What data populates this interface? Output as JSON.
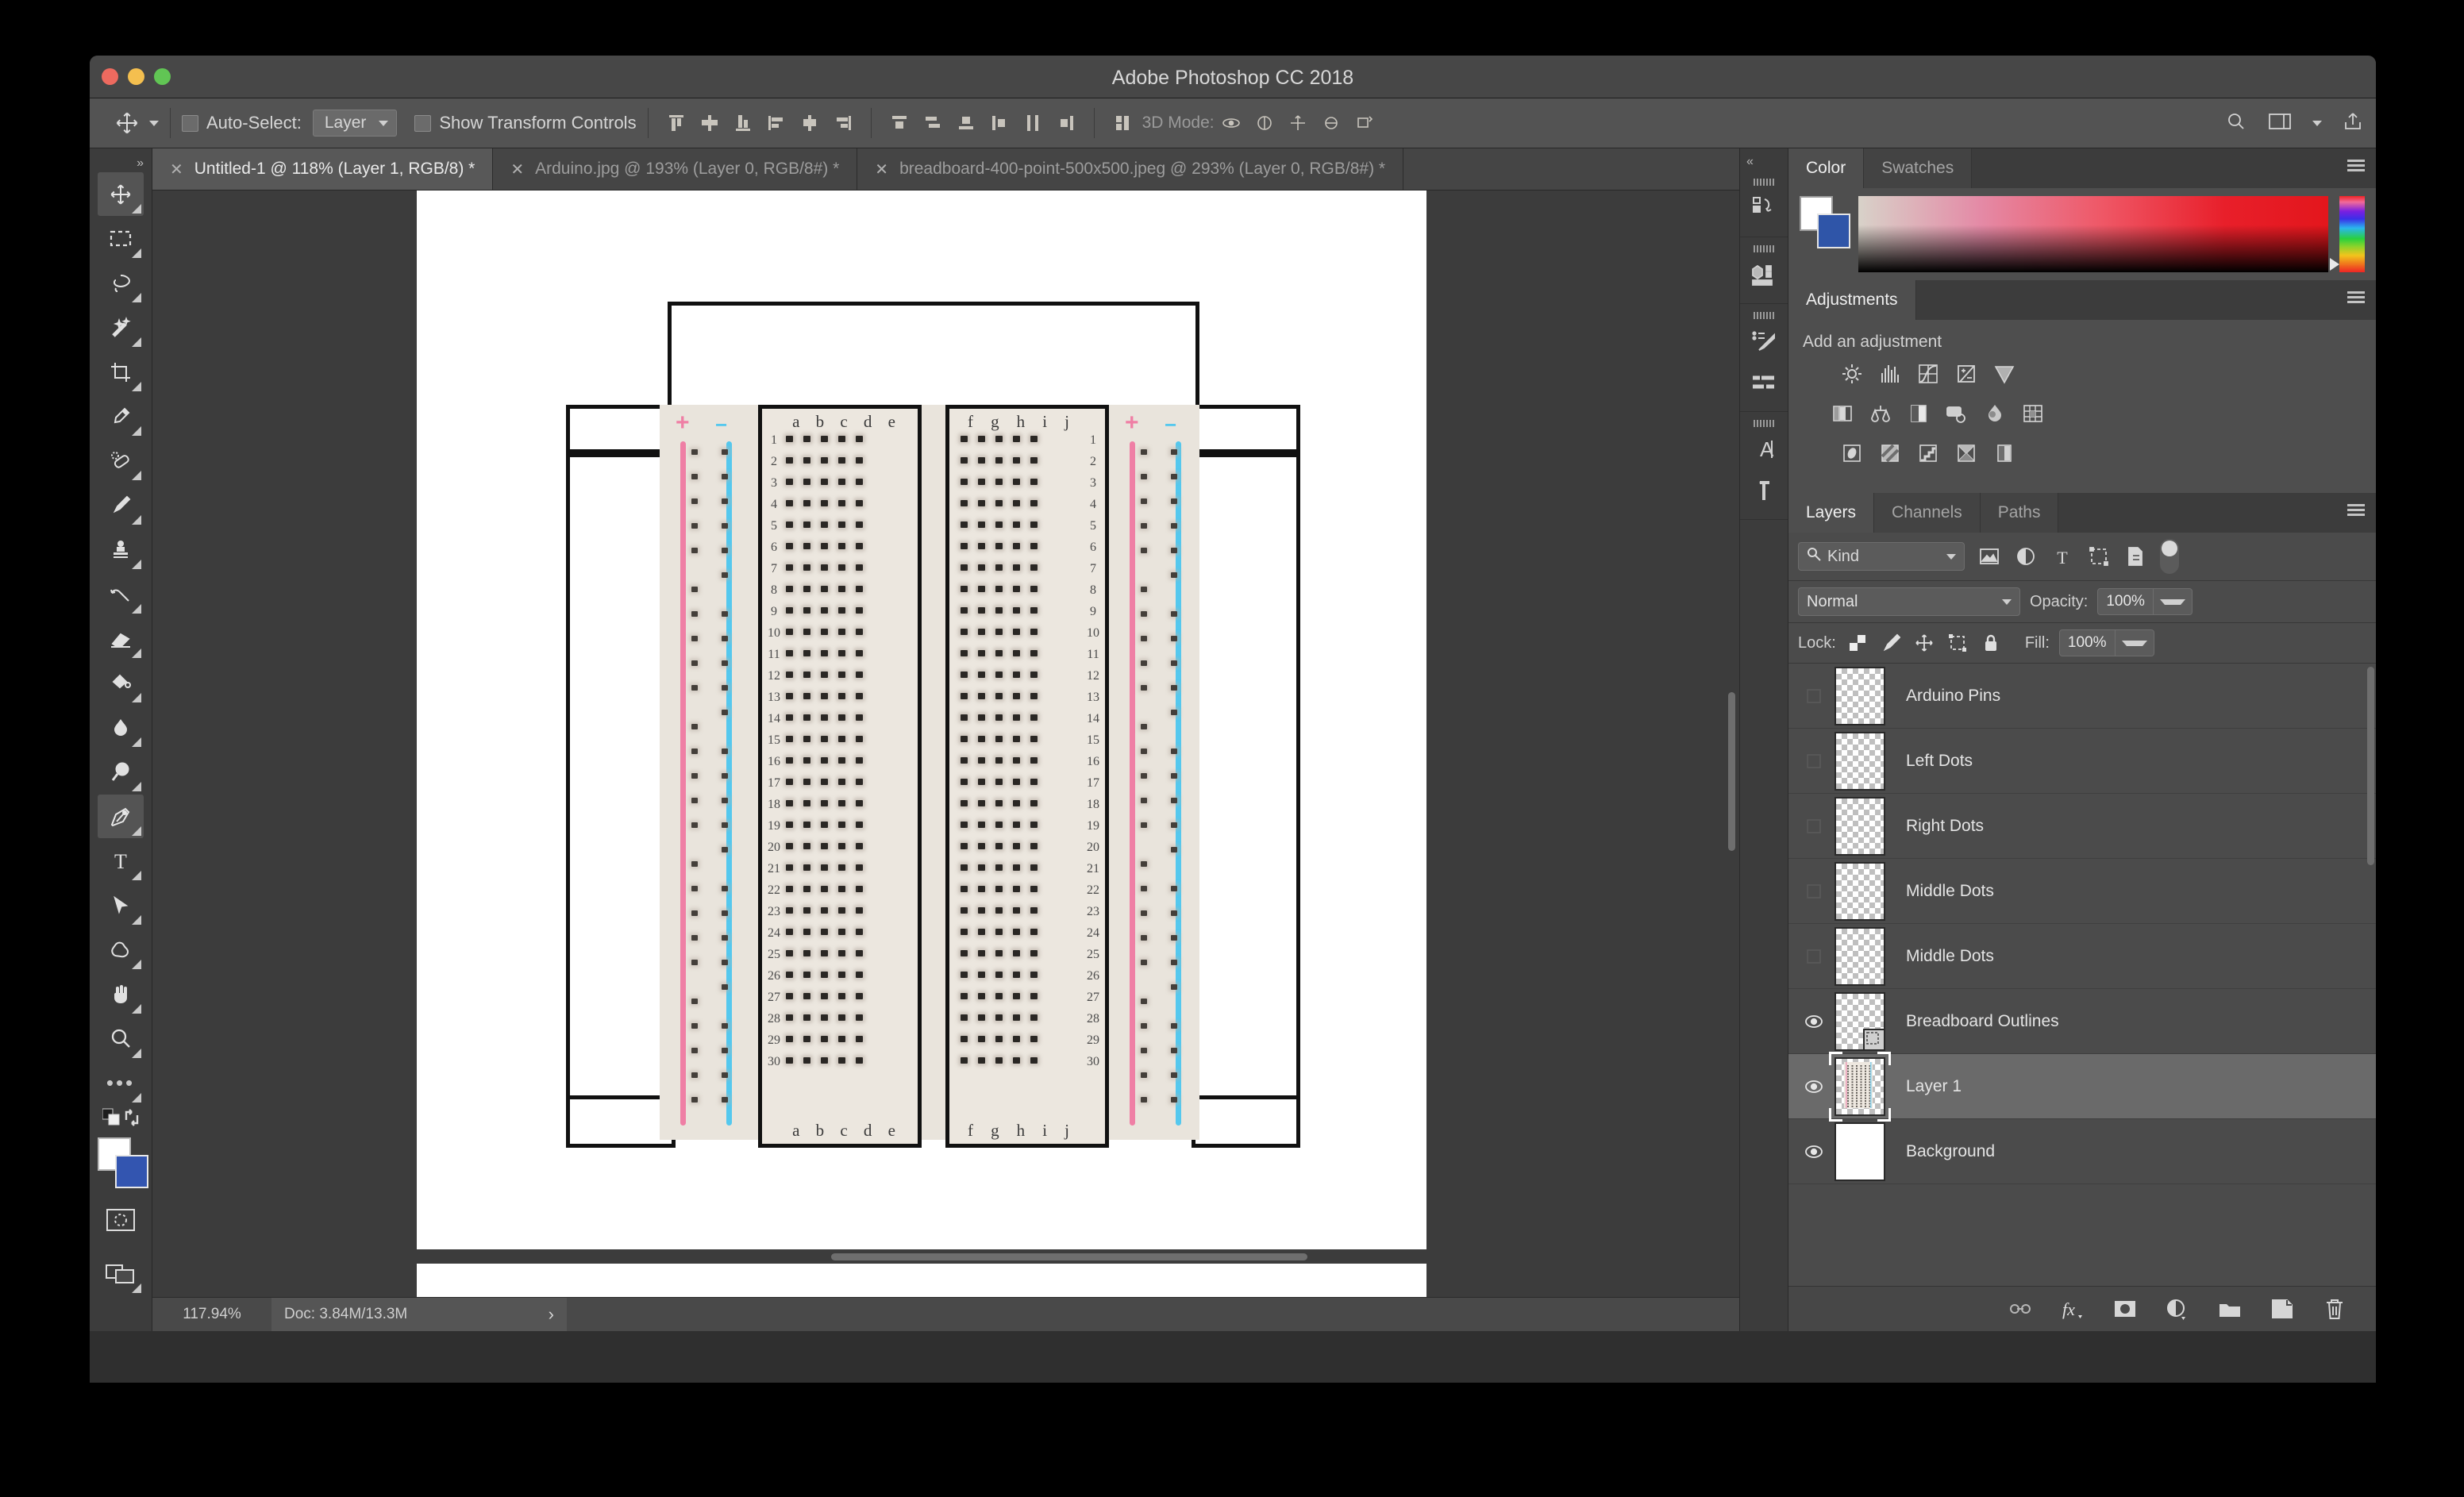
{
  "window": {
    "title": "Adobe Photoshop CC 2018"
  },
  "options_bar": {
    "tool_icon": "move-tool-icon",
    "auto_select_label": "Auto-Select:",
    "auto_select_value": "Layer",
    "show_transform_label": "Show Transform Controls",
    "mode_3d_label": "3D Mode:",
    "align_icons": [
      "align-top-edges",
      "align-vertical-centers",
      "align-bottom-edges",
      "align-left-edges",
      "align-horizontal-centers",
      "align-right-edges"
    ],
    "distribute_icons": [
      "distribute-top-edges",
      "distribute-vertical-centers",
      "distribute-bottom-edges",
      "distribute-left-edges",
      "distribute-horizontal-centers",
      "distribute-right-edges"
    ],
    "extra_icons": [
      "distribute-spacing",
      "3d-orbit",
      "3d-roll",
      "3d-pan",
      "3d-slide",
      "3d-scale"
    ],
    "right_icons": [
      "search-icon",
      "workspace-icon",
      "chevron-down-icon",
      "share-icon"
    ]
  },
  "toolbar": {
    "expand_label": "»",
    "tools": [
      {
        "name": "move-tool",
        "active": true
      },
      {
        "name": "rectangular-marquee-tool",
        "active": false
      },
      {
        "name": "lasso-tool",
        "active": false
      },
      {
        "name": "magic-wand-tool",
        "active": false
      },
      {
        "name": "crop-tool",
        "active": false
      },
      {
        "name": "eyedropper-tool",
        "active": false
      },
      {
        "name": "healing-brush-tool",
        "active": false
      },
      {
        "name": "brush-tool",
        "active": false
      },
      {
        "name": "clone-stamp-tool",
        "active": false
      },
      {
        "name": "history-brush-tool",
        "active": false
      },
      {
        "name": "eraser-tool",
        "active": false
      },
      {
        "name": "gradient-tool",
        "active": false
      },
      {
        "name": "blur-tool",
        "active": false
      },
      {
        "name": "dodge-tool",
        "active": false
      },
      {
        "name": "pen-tool",
        "active": true
      },
      {
        "name": "type-tool",
        "active": false
      },
      {
        "name": "path-selection-tool",
        "active": false
      },
      {
        "name": "custom-shape-tool",
        "active": false
      },
      {
        "name": "hand-tool",
        "active": false
      },
      {
        "name": "zoom-tool",
        "active": false
      },
      {
        "name": "edit-toolbar-tool",
        "active": false
      }
    ],
    "foreground_color": "#ffffff",
    "background_color": "#3355b0"
  },
  "document_tabs": [
    {
      "title": "Untitled-1 @ 118% (Layer 1, RGB/8) *",
      "active": true
    },
    {
      "title": "Arduino.jpg @ 193% (Layer 0, RGB/8#) *",
      "active": false
    },
    {
      "title": "breadboard-400-point-500x500.jpeg @ 293% (Layer 0, RGB/8#) *",
      "active": false
    }
  ],
  "status_bar": {
    "zoom": "117.94%",
    "doc": "Doc: 3.84M/13.3M",
    "arrow": "›"
  },
  "canvas": {
    "breadboard": {
      "left_columns": [
        "a",
        "b",
        "c",
        "d",
        "e"
      ],
      "right_columns": [
        "f",
        "g",
        "h",
        "i",
        "j"
      ],
      "row_numbers": [
        1,
        2,
        3,
        4,
        5,
        6,
        7,
        8,
        9,
        10,
        11,
        12,
        13,
        14,
        15,
        16,
        17,
        18,
        19,
        20,
        21,
        22,
        23,
        24,
        25,
        26,
        27,
        28,
        29,
        30
      ],
      "rail_plus": "+",
      "rail_minus": "−",
      "rail_plus_color": "#ef7fa5",
      "rail_minus_color": "#55c8ee",
      "board_color": "#e9e4dc",
      "outline_color": "#111111"
    }
  },
  "dock": {
    "icons": [
      "history-icon",
      "3d-icon",
      "brush-presets-icon",
      "brush-settings-icon",
      "character-icon",
      "paragraph-icon"
    ]
  },
  "color_panel": {
    "tabs": [
      {
        "label": "Color",
        "active": true
      },
      {
        "label": "Swatches",
        "active": false
      }
    ],
    "menu_icon": "panel-menu-icon",
    "foreground_color": "#ffffff",
    "background_color": "#2f55a8"
  },
  "adjustments_panel": {
    "tab": "Adjustments",
    "menu_icon": "panel-menu-icon",
    "hint": "Add an adjustment",
    "rows": [
      [
        "brightness-contrast-icon",
        "levels-icon",
        "curves-icon",
        "exposure-icon",
        "vibrance-icon"
      ],
      [
        "hue-saturation-icon",
        "color-balance-icon",
        "black-white-icon",
        "photo-filter-icon",
        "channel-mixer-icon",
        "color-lookup-icon"
      ],
      [
        "invert-icon",
        "posterize-icon",
        "threshold-icon",
        "gradient-map-icon",
        "selective-color-icon"
      ]
    ]
  },
  "layers_panel": {
    "tabs": [
      {
        "label": "Layers",
        "active": true
      },
      {
        "label": "Channels",
        "active": false
      },
      {
        "label": "Paths",
        "active": false
      }
    ],
    "menu_icon": "panel-menu-icon",
    "filter": {
      "kind_label": "Kind",
      "search_icon": "search-icon",
      "chevron": "chevron-down-icon",
      "type_icons": [
        "pixel-layer-filter-icon",
        "adjustment-layer-filter-icon",
        "type-layer-filter-icon",
        "shape-layer-filter-icon",
        "smart-object-filter-icon"
      ],
      "toggle": "filter-toggle"
    },
    "blend_mode": "Normal",
    "opacity_label": "Opacity:",
    "opacity_value": "100%",
    "lock_label": "Lock:",
    "lock_icons": [
      "lock-transparent-pixels-icon",
      "lock-image-pixels-icon",
      "lock-position-icon",
      "lock-artboard-icon",
      "lock-all-icon"
    ],
    "fill_label": "Fill:",
    "fill_value": "100%",
    "layers": [
      {
        "name": "Arduino Pins",
        "visible": false,
        "selected": false,
        "thumb": "checker"
      },
      {
        "name": "Left Dots",
        "visible": false,
        "selected": false,
        "thumb": "checker"
      },
      {
        "name": "Right Dots",
        "visible": false,
        "selected": false,
        "thumb": "checker"
      },
      {
        "name": "Middle Dots",
        "visible": false,
        "selected": false,
        "thumb": "checker"
      },
      {
        "name": "Middle Dots",
        "visible": false,
        "selected": false,
        "thumb": "checker"
      },
      {
        "name": "Breadboard Outlines",
        "visible": true,
        "selected": false,
        "thumb": "checker"
      },
      {
        "name": "Layer 1",
        "visible": true,
        "selected": true,
        "thumb": "breadboard"
      },
      {
        "name": "Background",
        "visible": true,
        "selected": false,
        "thumb": "white"
      }
    ],
    "footer_icons": [
      "link-layers-icon",
      "layer-style-fx-icon",
      "add-layer-mask-icon",
      "new-adjustment-layer-icon",
      "new-group-icon",
      "new-layer-icon",
      "delete-layer-icon"
    ]
  }
}
